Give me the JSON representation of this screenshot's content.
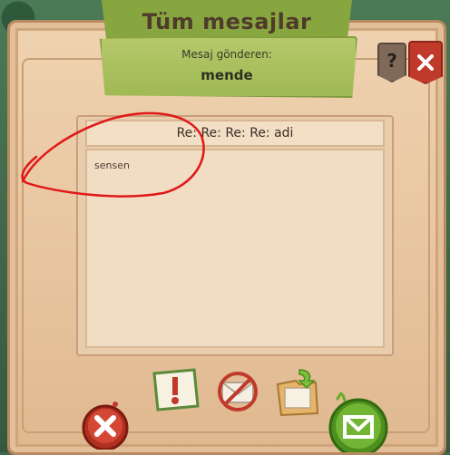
{
  "window": {
    "title": "Tüm mesajlar",
    "help_label": "?",
    "close_label": "✕"
  },
  "sender": {
    "label": "Mesaj gönderen:",
    "name": "mende"
  },
  "message": {
    "subject": "Re: Re: Re: Re: adi",
    "body": "sensen"
  },
  "actions": {
    "delete_icon": "delete-icon",
    "report_icon": "report-icon",
    "block_icon": "block-icon",
    "archive_icon": "archive-icon",
    "reply_icon": "reply-icon"
  },
  "colors": {
    "banner_green": "#87a63f",
    "parchment": "#e8c59f",
    "danger_red": "#c03a2b",
    "reply_green": "#6aaa2a",
    "annotation_red": "#e01818"
  }
}
